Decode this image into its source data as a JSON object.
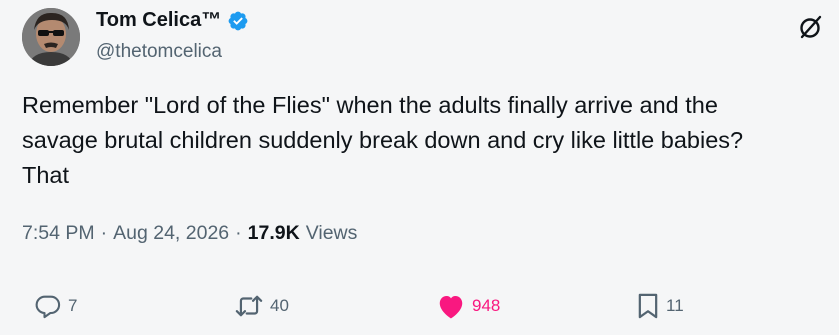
{
  "author": {
    "name": "Tom Celica™",
    "handle": "@thetomcelica"
  },
  "tweet": {
    "text": "Remember \"Lord of the Flies\" when the adults finally arrive and the\nsavage brutal children suddenly break down and cry like little babies?\nThat"
  },
  "meta": {
    "time": "7:54 PM",
    "dot1": "·",
    "date": "Aug 24, 2026",
    "dot2": "·",
    "views_count": "17.9K",
    "views_label": "Views"
  },
  "actions": {
    "replies": "7",
    "reposts": "40",
    "likes": "948",
    "bookmarks": "11"
  },
  "colors": {
    "verified": "#1d9bf0",
    "like": "#f91880",
    "secondary_text": "#536471"
  },
  "icons": [
    "verified-badge-icon",
    "grok-icon",
    "reply-icon",
    "repost-icon",
    "like-icon",
    "bookmark-icon"
  ]
}
